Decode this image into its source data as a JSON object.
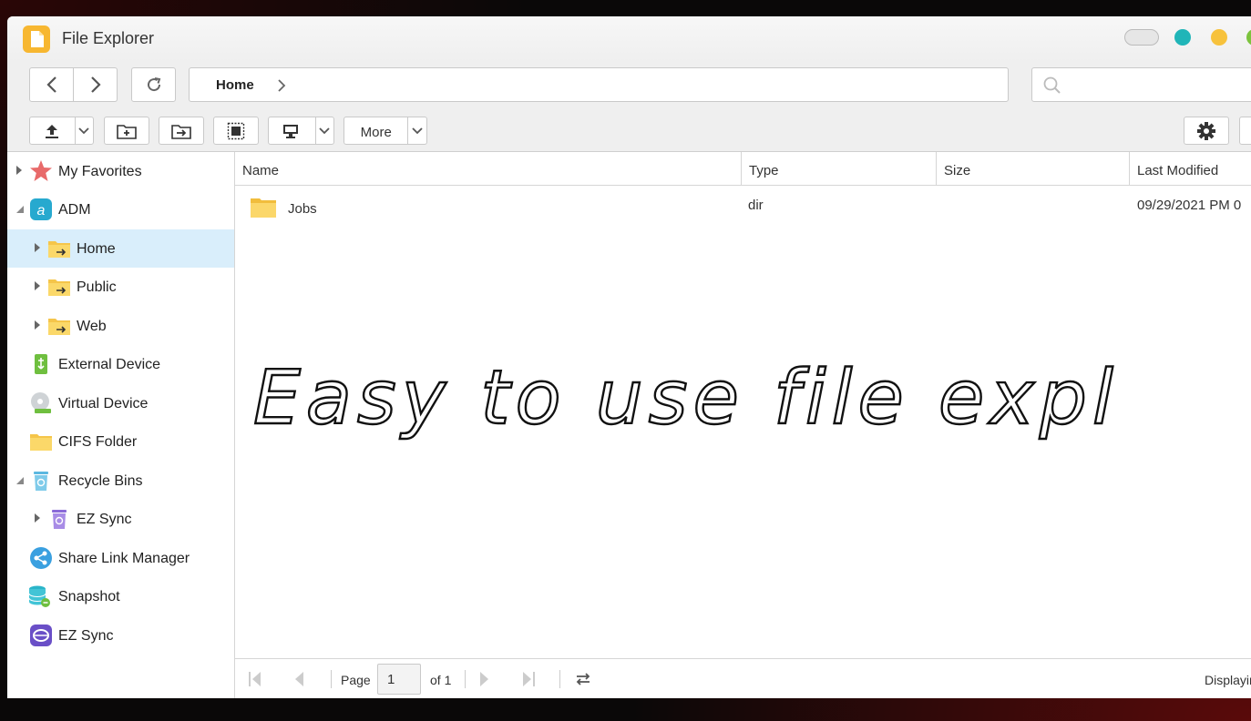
{
  "window": {
    "title": "File Explorer"
  },
  "breadcrumb": {
    "items": [
      "Home"
    ]
  },
  "search": {
    "placeholder": ""
  },
  "toolbar": {
    "more_label": "More"
  },
  "sidebar": {
    "items": [
      {
        "label": "My Favorites",
        "icon": "star-icon",
        "level": 0,
        "expander": "collapsed"
      },
      {
        "label": "ADM",
        "icon": "adm-icon",
        "level": 0,
        "expander": "expanded"
      },
      {
        "label": "Home",
        "icon": "shared-folder-icon",
        "level": 1,
        "expander": "collapsed",
        "selected": true
      },
      {
        "label": "Public",
        "icon": "shared-folder-icon",
        "level": 1,
        "expander": "collapsed"
      },
      {
        "label": "Web",
        "icon": "shared-folder-icon",
        "level": 1,
        "expander": "collapsed"
      },
      {
        "label": "External Device",
        "icon": "usb-icon",
        "level": 0,
        "expander": "none"
      },
      {
        "label": "Virtual Device",
        "icon": "disc-icon",
        "level": 0,
        "expander": "none"
      },
      {
        "label": "CIFS Folder",
        "icon": "folder-icon",
        "level": 0,
        "expander": "none"
      },
      {
        "label": "Recycle Bins",
        "icon": "recycle-bin-icon",
        "level": 0,
        "expander": "expanded"
      },
      {
        "label": "EZ Sync",
        "icon": "recycle-bin-purple-icon",
        "level": 1,
        "expander": "collapsed"
      },
      {
        "label": "Share Link Manager",
        "icon": "share-icon",
        "level": 0,
        "expander": "none"
      },
      {
        "label": "Snapshot",
        "icon": "snapshot-icon",
        "level": 0,
        "expander": "none"
      },
      {
        "label": "EZ Sync",
        "icon": "ez-sync-icon",
        "level": 0,
        "expander": "none"
      }
    ]
  },
  "table": {
    "columns": [
      "Name",
      "Type",
      "Size",
      "Last Modified"
    ],
    "rows": [
      {
        "name": "Jobs",
        "type": "dir",
        "size": "",
        "modified": "09/29/2021 PM 0"
      }
    ]
  },
  "overlay": {
    "handwriting": "Easy to use file explorer"
  },
  "pager": {
    "page_label": "Page",
    "page_value": "1",
    "of_label": "of 1",
    "display_text": "Displayin"
  },
  "colors": {
    "selected_row": "#d9eefb",
    "accent_teal": "#20b5b8",
    "accent_yellow": "#f7c23c",
    "accent_green": "#7cc33d",
    "folder": "#f5c54a"
  }
}
